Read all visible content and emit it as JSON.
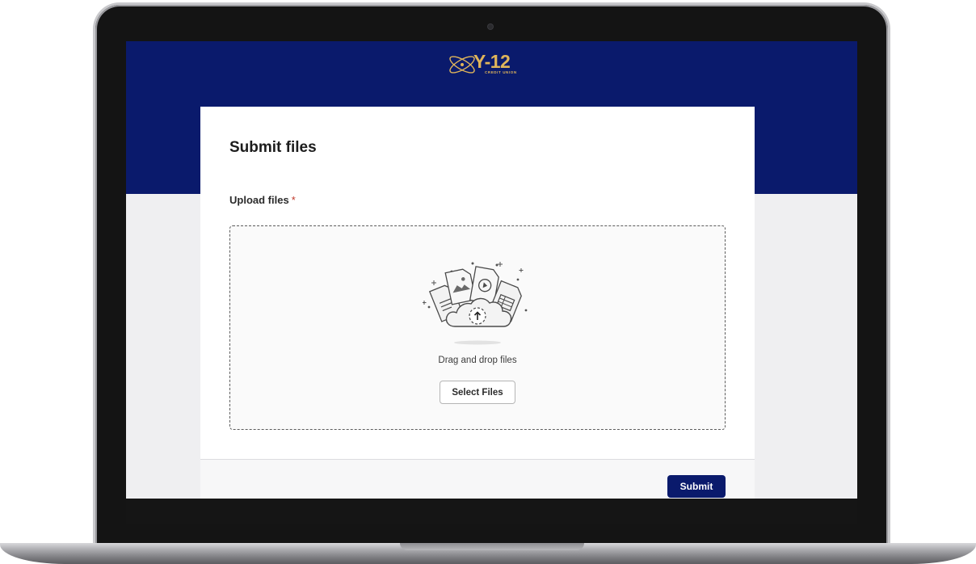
{
  "brand": {
    "logo_text": "Y-12",
    "logo_subtext": "CREDIT UNION",
    "primary_color": "#0a1a6c",
    "accent_color": "#e0b55a"
  },
  "form": {
    "title": "Submit files",
    "upload_label": "Upload files",
    "required_marker": "*",
    "dropzone": {
      "instruction": "Drag and drop files",
      "select_button_label": "Select Files",
      "illustration_icon": "cloud-upload-files-icon"
    },
    "submit_label": "Submit"
  }
}
